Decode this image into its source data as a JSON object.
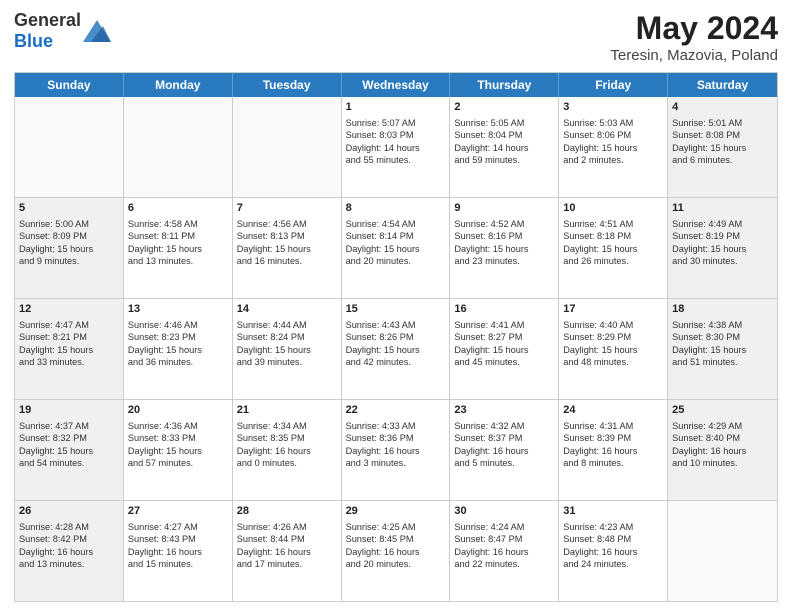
{
  "header": {
    "logo_general": "General",
    "logo_blue": "Blue",
    "title": "May 2024",
    "subtitle": "Teresin, Mazovia, Poland"
  },
  "days_of_week": [
    "Sunday",
    "Monday",
    "Tuesday",
    "Wednesday",
    "Thursday",
    "Friday",
    "Saturday"
  ],
  "weeks": [
    [
      {
        "day": "",
        "info": "",
        "empty": true
      },
      {
        "day": "",
        "info": "",
        "empty": true
      },
      {
        "day": "",
        "info": "",
        "empty": true
      },
      {
        "day": "1",
        "info": "Sunrise: 5:07 AM\nSunset: 8:03 PM\nDaylight: 14 hours\nand 55 minutes.",
        "empty": false,
        "shaded": false
      },
      {
        "day": "2",
        "info": "Sunrise: 5:05 AM\nSunset: 8:04 PM\nDaylight: 14 hours\nand 59 minutes.",
        "empty": false,
        "shaded": false
      },
      {
        "day": "3",
        "info": "Sunrise: 5:03 AM\nSunset: 8:06 PM\nDaylight: 15 hours\nand 2 minutes.",
        "empty": false,
        "shaded": false
      },
      {
        "day": "4",
        "info": "Sunrise: 5:01 AM\nSunset: 8:08 PM\nDaylight: 15 hours\nand 6 minutes.",
        "empty": false,
        "shaded": true
      }
    ],
    [
      {
        "day": "5",
        "info": "Sunrise: 5:00 AM\nSunset: 8:09 PM\nDaylight: 15 hours\nand 9 minutes.",
        "empty": false,
        "shaded": true
      },
      {
        "day": "6",
        "info": "Sunrise: 4:58 AM\nSunset: 8:11 PM\nDaylight: 15 hours\nand 13 minutes.",
        "empty": false,
        "shaded": false
      },
      {
        "day": "7",
        "info": "Sunrise: 4:56 AM\nSunset: 8:13 PM\nDaylight: 15 hours\nand 16 minutes.",
        "empty": false,
        "shaded": false
      },
      {
        "day": "8",
        "info": "Sunrise: 4:54 AM\nSunset: 8:14 PM\nDaylight: 15 hours\nand 20 minutes.",
        "empty": false,
        "shaded": false
      },
      {
        "day": "9",
        "info": "Sunrise: 4:52 AM\nSunset: 8:16 PM\nDaylight: 15 hours\nand 23 minutes.",
        "empty": false,
        "shaded": false
      },
      {
        "day": "10",
        "info": "Sunrise: 4:51 AM\nSunset: 8:18 PM\nDaylight: 15 hours\nand 26 minutes.",
        "empty": false,
        "shaded": false
      },
      {
        "day": "11",
        "info": "Sunrise: 4:49 AM\nSunset: 8:19 PM\nDaylight: 15 hours\nand 30 minutes.",
        "empty": false,
        "shaded": true
      }
    ],
    [
      {
        "day": "12",
        "info": "Sunrise: 4:47 AM\nSunset: 8:21 PM\nDaylight: 15 hours\nand 33 minutes.",
        "empty": false,
        "shaded": true
      },
      {
        "day": "13",
        "info": "Sunrise: 4:46 AM\nSunset: 8:23 PM\nDaylight: 15 hours\nand 36 minutes.",
        "empty": false,
        "shaded": false
      },
      {
        "day": "14",
        "info": "Sunrise: 4:44 AM\nSunset: 8:24 PM\nDaylight: 15 hours\nand 39 minutes.",
        "empty": false,
        "shaded": false
      },
      {
        "day": "15",
        "info": "Sunrise: 4:43 AM\nSunset: 8:26 PM\nDaylight: 15 hours\nand 42 minutes.",
        "empty": false,
        "shaded": false
      },
      {
        "day": "16",
        "info": "Sunrise: 4:41 AM\nSunset: 8:27 PM\nDaylight: 15 hours\nand 45 minutes.",
        "empty": false,
        "shaded": false
      },
      {
        "day": "17",
        "info": "Sunrise: 4:40 AM\nSunset: 8:29 PM\nDaylight: 15 hours\nand 48 minutes.",
        "empty": false,
        "shaded": false
      },
      {
        "day": "18",
        "info": "Sunrise: 4:38 AM\nSunset: 8:30 PM\nDaylight: 15 hours\nand 51 minutes.",
        "empty": false,
        "shaded": true
      }
    ],
    [
      {
        "day": "19",
        "info": "Sunrise: 4:37 AM\nSunset: 8:32 PM\nDaylight: 15 hours\nand 54 minutes.",
        "empty": false,
        "shaded": true
      },
      {
        "day": "20",
        "info": "Sunrise: 4:36 AM\nSunset: 8:33 PM\nDaylight: 15 hours\nand 57 minutes.",
        "empty": false,
        "shaded": false
      },
      {
        "day": "21",
        "info": "Sunrise: 4:34 AM\nSunset: 8:35 PM\nDaylight: 16 hours\nand 0 minutes.",
        "empty": false,
        "shaded": false
      },
      {
        "day": "22",
        "info": "Sunrise: 4:33 AM\nSunset: 8:36 PM\nDaylight: 16 hours\nand 3 minutes.",
        "empty": false,
        "shaded": false
      },
      {
        "day": "23",
        "info": "Sunrise: 4:32 AM\nSunset: 8:37 PM\nDaylight: 16 hours\nand 5 minutes.",
        "empty": false,
        "shaded": false
      },
      {
        "day": "24",
        "info": "Sunrise: 4:31 AM\nSunset: 8:39 PM\nDaylight: 16 hours\nand 8 minutes.",
        "empty": false,
        "shaded": false
      },
      {
        "day": "25",
        "info": "Sunrise: 4:29 AM\nSunset: 8:40 PM\nDaylight: 16 hours\nand 10 minutes.",
        "empty": false,
        "shaded": true
      }
    ],
    [
      {
        "day": "26",
        "info": "Sunrise: 4:28 AM\nSunset: 8:42 PM\nDaylight: 16 hours\nand 13 minutes.",
        "empty": false,
        "shaded": true
      },
      {
        "day": "27",
        "info": "Sunrise: 4:27 AM\nSunset: 8:43 PM\nDaylight: 16 hours\nand 15 minutes.",
        "empty": false,
        "shaded": false
      },
      {
        "day": "28",
        "info": "Sunrise: 4:26 AM\nSunset: 8:44 PM\nDaylight: 16 hours\nand 17 minutes.",
        "empty": false,
        "shaded": false
      },
      {
        "day": "29",
        "info": "Sunrise: 4:25 AM\nSunset: 8:45 PM\nDaylight: 16 hours\nand 20 minutes.",
        "empty": false,
        "shaded": false
      },
      {
        "day": "30",
        "info": "Sunrise: 4:24 AM\nSunset: 8:47 PM\nDaylight: 16 hours\nand 22 minutes.",
        "empty": false,
        "shaded": false
      },
      {
        "day": "31",
        "info": "Sunrise: 4:23 AM\nSunset: 8:48 PM\nDaylight: 16 hours\nand 24 minutes.",
        "empty": false,
        "shaded": false
      },
      {
        "day": "",
        "info": "",
        "empty": true,
        "shaded": true
      }
    ]
  ]
}
